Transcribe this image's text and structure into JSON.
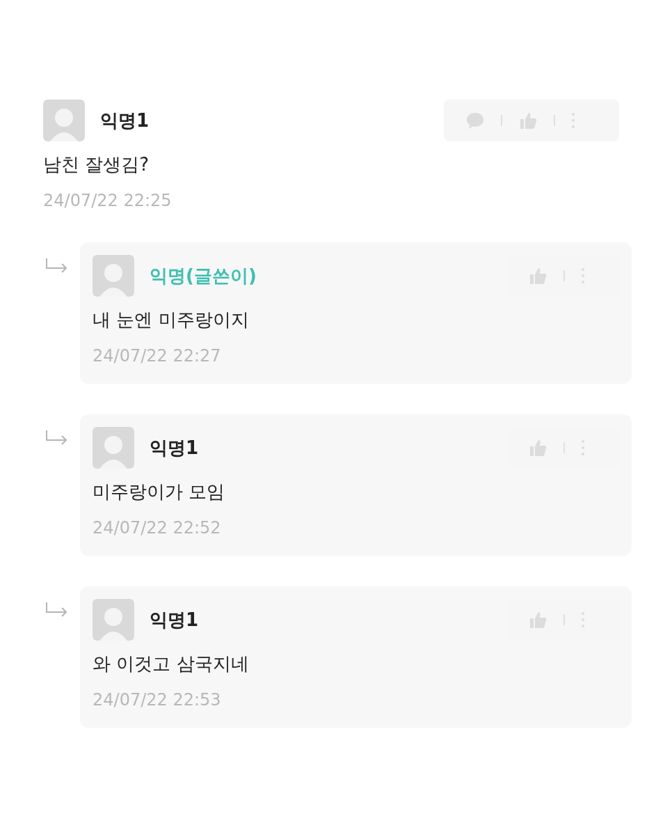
{
  "comments": [
    {
      "kind": "top",
      "author": "익명1",
      "is_writer": false,
      "text": "남친 잘생김?",
      "date": "24/07/22 22:25"
    },
    {
      "kind": "reply",
      "author": "익명(글쓴이)",
      "is_writer": true,
      "text": "내 눈엔 미주랑이지",
      "date": "24/07/22 22:27"
    },
    {
      "kind": "reply",
      "author": "익명1",
      "is_writer": false,
      "text": "미주랑이가 모임",
      "date": "24/07/22 22:52"
    },
    {
      "kind": "reply",
      "author": "익명1",
      "is_writer": false,
      "text": "와 이것고 삼국지네",
      "date": "24/07/22 22:53"
    }
  ]
}
